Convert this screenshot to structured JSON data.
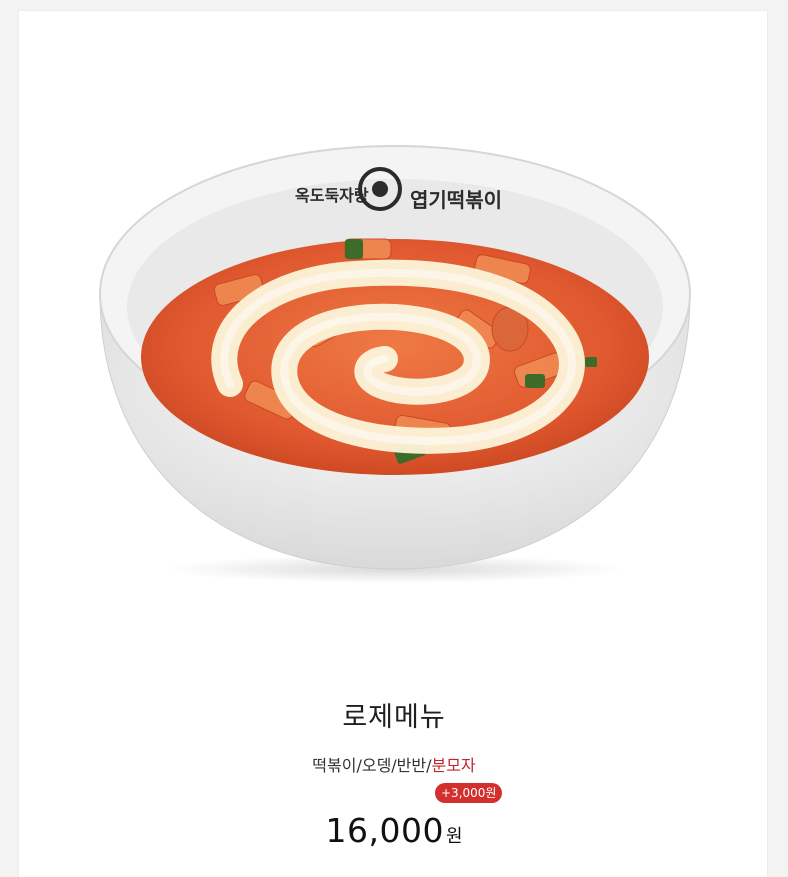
{
  "product": {
    "image_alt": "rose tteokbokki bowl",
    "bowl_brand_text": "옥도둑자랑 엽기떡볶이",
    "title": "로제메뉴",
    "options_text": "떡볶이/오뎅/반반/",
    "options_highlight": "분모자",
    "addon_badge": "+3,000원",
    "price": "16,000",
    "price_unit": "원"
  },
  "colors": {
    "highlight": "#c1272d",
    "badge_bg": "#d32f2f",
    "sauce": "#e2633a",
    "cheese": "#fbf2d6"
  }
}
